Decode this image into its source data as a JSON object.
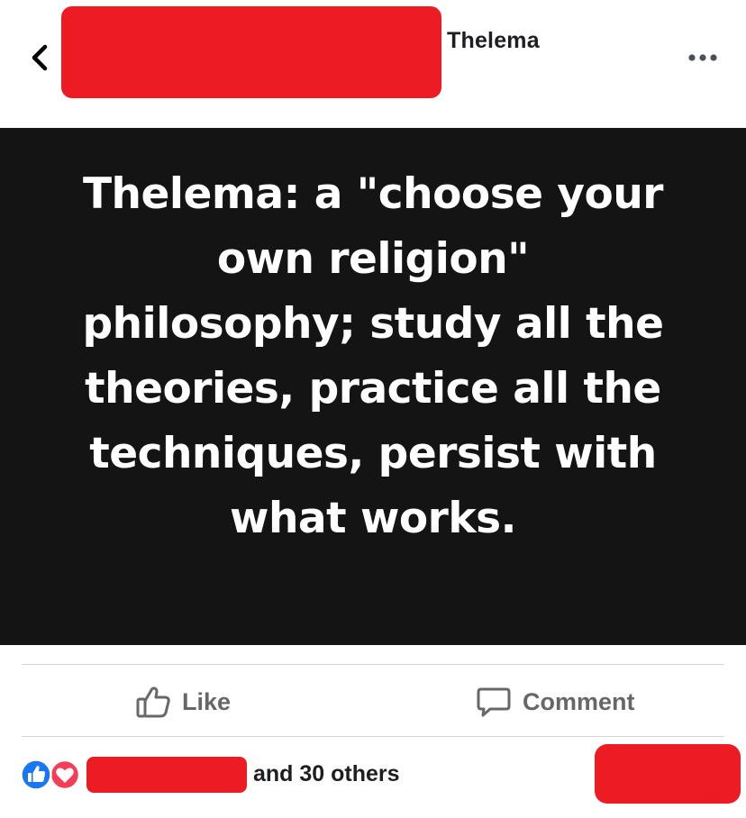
{
  "header": {
    "group_name": "Thelema",
    "back_icon": "chevron-left-icon",
    "more_icon": "more-dots-icon"
  },
  "post": {
    "image_text": "Thelema: a \"choose your own religion\" philosophy; study all the theories, practice all the techniques, persist with what works.",
    "image_background": "#141414",
    "text_color": "#ffffff"
  },
  "actions": {
    "like_label": "Like",
    "comment_label": "Comment",
    "icon_color": "#65676b"
  },
  "reactions": {
    "icons": [
      "like-reaction-icon",
      "love-reaction-icon"
    ],
    "summary_text": "and 30 others",
    "like_color": "#1877f2",
    "love_color": "#f33e58"
  },
  "redaction_color": "#ed1c24"
}
